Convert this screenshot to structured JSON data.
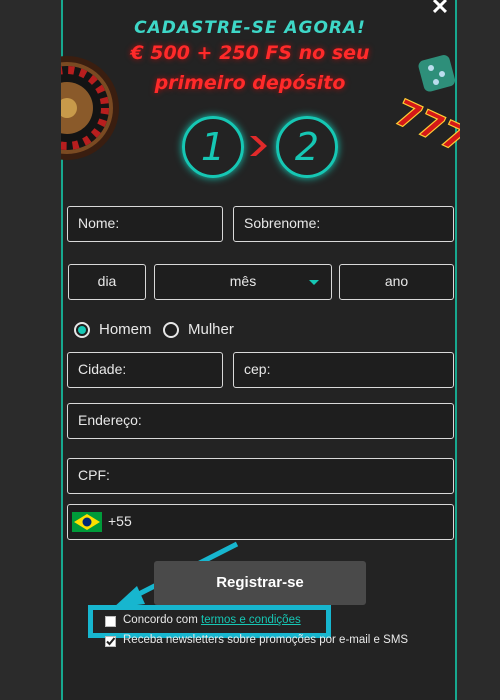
{
  "header": {
    "line1": "CADASTRE-SE AGORA!",
    "line2": "€ 500 + 250 FS no seu",
    "line3": "primeiro depósito",
    "close_icon": "✕"
  },
  "steps": [
    "1",
    "2"
  ],
  "form": {
    "nome_placeholder": "Nome:",
    "sobrenome_placeholder": "Sobrenome:",
    "dia_label": "dia",
    "mes_label": "mês",
    "ano_label": "ano",
    "gender": {
      "selected": "Homem",
      "options": [
        "Homem",
        "Mulher"
      ]
    },
    "cidade_placeholder": "Cidade:",
    "cep_placeholder": "cep:",
    "endereco_placeholder": "Endereço:",
    "cpf_placeholder": "CPF:",
    "phone_prefix": "+55",
    "submit_label": "Registrar-se",
    "terms_text": "Concordo com",
    "terms_link": "termos e condições",
    "terms_checked": false,
    "newsletter_text": "Receba newsletters sobre promoções por e-mail e SMS",
    "newsletter_checked": true
  },
  "colors": {
    "accent": "#16c7b4",
    "promo_red": "#ff2a2a",
    "highlight": "#17b6cf"
  },
  "decorations": [
    "roulette-wheel",
    "green-dice",
    "slot-777"
  ]
}
